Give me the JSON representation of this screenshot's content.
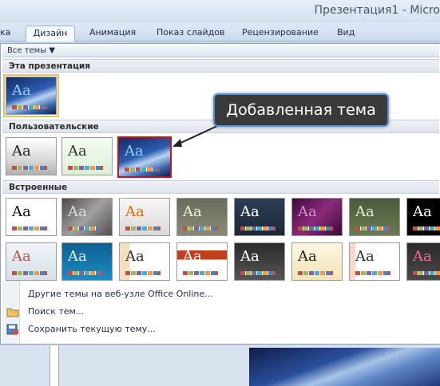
{
  "window": {
    "title": "Презентация1 - Micro"
  },
  "ribbon": {
    "tabs": [
      {
        "label": "ка"
      },
      {
        "label": "Дизайн"
      },
      {
        "label": "Анимация"
      },
      {
        "label": "Показ слайдов"
      },
      {
        "label": "Рецензирование"
      },
      {
        "label": "Вид"
      }
    ]
  },
  "gallery": {
    "filter_label": "Все темы ▼",
    "sections": [
      {
        "label": "Эта презентация"
      },
      {
        "label": "Пользовательские"
      },
      {
        "label": "Встроенные"
      }
    ],
    "thumb_text": "Aa"
  },
  "callout": {
    "text": "Добавленная тема"
  },
  "menu": {
    "items": [
      {
        "label": "Другие темы на веб-узле Office Online..."
      },
      {
        "label": "Поиск тем..."
      },
      {
        "label": "Сохранить текущую тему..."
      }
    ]
  },
  "colors": {
    "callout_border": "#5b8fd6",
    "highlight": "#d01010",
    "selected": "#f0c05a"
  }
}
